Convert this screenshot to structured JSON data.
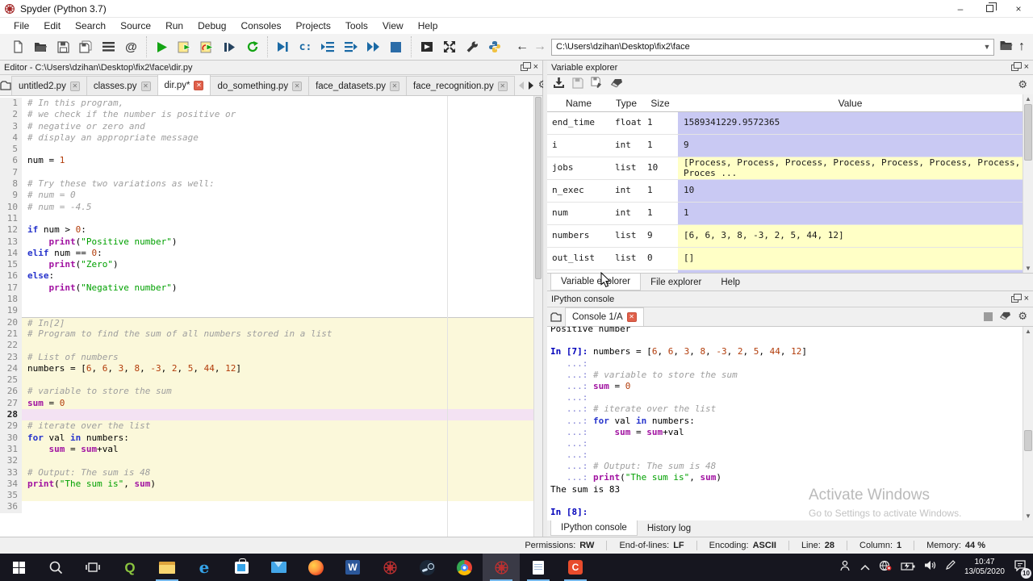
{
  "window": {
    "title": "Spyder (Python 3.7)"
  },
  "menu_bar": {
    "items": [
      "File",
      "Edit",
      "Search",
      "Source",
      "Run",
      "Debug",
      "Consoles",
      "Projects",
      "Tools",
      "View",
      "Help"
    ]
  },
  "toolbar": {
    "path": "C:\\Users\\dzihan\\Desktop\\fix2\\face"
  },
  "editor": {
    "panel_title": "Editor - C:\\Users\\dzihan\\Desktop\\fix2\\face\\dir.py",
    "tabs": [
      {
        "label": "untitled2.py",
        "active": false
      },
      {
        "label": "classes.py",
        "active": false
      },
      {
        "label": "dir.py*",
        "active": true
      },
      {
        "label": "do_something.py",
        "active": false
      },
      {
        "label": "face_datasets.py",
        "active": false
      },
      {
        "label": "face_recognition.py",
        "active": false
      }
    ],
    "lines": [
      {
        "n": 1,
        "bg": "",
        "t": [
          [
            "# In this program,",
            "c"
          ]
        ]
      },
      {
        "n": 2,
        "bg": "",
        "t": [
          [
            "# we check if the number is positive or",
            "c"
          ]
        ]
      },
      {
        "n": 3,
        "bg": "",
        "t": [
          [
            "# negative or zero and",
            "c"
          ]
        ]
      },
      {
        "n": 4,
        "bg": "",
        "t": [
          [
            "# display an appropriate message",
            "c"
          ]
        ]
      },
      {
        "n": 5,
        "bg": "",
        "t": []
      },
      {
        "n": 6,
        "bg": "",
        "t": [
          [
            "num = ",
            "p"
          ],
          [
            "1",
            "n"
          ]
        ]
      },
      {
        "n": 7,
        "bg": "",
        "t": []
      },
      {
        "n": 8,
        "bg": "",
        "t": [
          [
            "# Try these two variations as well:",
            "c"
          ]
        ]
      },
      {
        "n": 9,
        "bg": "",
        "t": [
          [
            "# num = 0",
            "c"
          ]
        ]
      },
      {
        "n": 10,
        "bg": "",
        "t": [
          [
            "# num = -4.5",
            "c"
          ]
        ]
      },
      {
        "n": 11,
        "bg": "",
        "t": []
      },
      {
        "n": 12,
        "bg": "",
        "t": [
          [
            "if",
            "k"
          ],
          [
            " num > ",
            "p"
          ],
          [
            "0",
            "n"
          ],
          [
            ":",
            "p"
          ]
        ]
      },
      {
        "n": 13,
        "bg": "",
        "t": [
          [
            "    ",
            "p"
          ],
          [
            "print",
            "b"
          ],
          [
            "(",
            "p"
          ],
          [
            "\"Positive number\"",
            "s"
          ],
          [
            ")",
            "p"
          ]
        ]
      },
      {
        "n": 14,
        "bg": "",
        "t": [
          [
            "elif",
            "k"
          ],
          [
            " num == ",
            "p"
          ],
          [
            "0",
            "n"
          ],
          [
            ":",
            "p"
          ]
        ]
      },
      {
        "n": 15,
        "bg": "",
        "t": [
          [
            "    ",
            "p"
          ],
          [
            "print",
            "b"
          ],
          [
            "(",
            "p"
          ],
          [
            "\"Zero\"",
            "s"
          ],
          [
            ")",
            "p"
          ]
        ]
      },
      {
        "n": 16,
        "bg": "",
        "t": [
          [
            "else",
            "k"
          ],
          [
            ":",
            "p"
          ]
        ]
      },
      {
        "n": 17,
        "bg": "",
        "t": [
          [
            "    ",
            "p"
          ],
          [
            "print",
            "b"
          ],
          [
            "(",
            "p"
          ],
          [
            "\"Negative number\"",
            "s"
          ],
          [
            ")",
            "p"
          ]
        ]
      },
      {
        "n": 18,
        "bg": "",
        "t": []
      },
      {
        "n": 19,
        "bg": "",
        "t": []
      },
      {
        "n": 20,
        "bg": "cellstart",
        "t": [
          [
            "# In[2]",
            "c"
          ]
        ]
      },
      {
        "n": 21,
        "bg": "cell",
        "t": [
          [
            "# Program to find the sum of all numbers stored in a list",
            "c"
          ]
        ]
      },
      {
        "n": 22,
        "bg": "cell",
        "t": []
      },
      {
        "n": 23,
        "bg": "cell",
        "t": [
          [
            "# List of numbers",
            "c"
          ]
        ]
      },
      {
        "n": 24,
        "bg": "cell",
        "t": [
          [
            "numbers = [",
            "p"
          ],
          [
            "6",
            "n"
          ],
          [
            ", ",
            "p"
          ],
          [
            "6",
            "n"
          ],
          [
            ", ",
            "p"
          ],
          [
            "3",
            "n"
          ],
          [
            ", ",
            "p"
          ],
          [
            "8",
            "n"
          ],
          [
            ", ",
            "p"
          ],
          [
            "-3",
            "n"
          ],
          [
            ", ",
            "p"
          ],
          [
            "2",
            "n"
          ],
          [
            ", ",
            "p"
          ],
          [
            "5",
            "n"
          ],
          [
            ", ",
            "p"
          ],
          [
            "44",
            "n"
          ],
          [
            ", ",
            "p"
          ],
          [
            "12",
            "n"
          ],
          [
            "]",
            "p"
          ]
        ]
      },
      {
        "n": 25,
        "bg": "cell",
        "t": []
      },
      {
        "n": 26,
        "bg": "cell",
        "t": [
          [
            "# variable to store the sum",
            "c"
          ]
        ]
      },
      {
        "n": 27,
        "bg": "cell",
        "t": [
          [
            "sum",
            "b"
          ],
          [
            " = ",
            "p"
          ],
          [
            "0",
            "n"
          ]
        ]
      },
      {
        "n": 28,
        "bg": "cur",
        "t": []
      },
      {
        "n": 29,
        "bg": "cell",
        "t": [
          [
            "# iterate over the list",
            "c"
          ]
        ]
      },
      {
        "n": 30,
        "bg": "cell",
        "t": [
          [
            "for",
            "k"
          ],
          [
            " val ",
            "p"
          ],
          [
            "in",
            "k"
          ],
          [
            " numbers:",
            "p"
          ]
        ]
      },
      {
        "n": 31,
        "bg": "cell",
        "t": [
          [
            "    ",
            "p"
          ],
          [
            "sum",
            "b"
          ],
          [
            " = ",
            "p"
          ],
          [
            "sum",
            "b"
          ],
          [
            "+val",
            "p"
          ]
        ]
      },
      {
        "n": 32,
        "bg": "cell",
        "t": []
      },
      {
        "n": 33,
        "bg": "cell",
        "t": [
          [
            "# Output: The sum is 48",
            "c"
          ]
        ]
      },
      {
        "n": 34,
        "bg": "cell",
        "t": [
          [
            "print",
            "b"
          ],
          [
            "(",
            "p"
          ],
          [
            "\"The sum is\"",
            "s"
          ],
          [
            ", ",
            "p"
          ],
          [
            "sum",
            "b"
          ],
          [
            ")",
            "p"
          ]
        ]
      },
      {
        "n": 35,
        "bg": "cell",
        "t": []
      },
      {
        "n": 36,
        "bg": "",
        "t": []
      }
    ]
  },
  "variable_explorer": {
    "panel_title": "Variable explorer",
    "columns": [
      "Name",
      "Type",
      "Size",
      "Value"
    ],
    "rows": [
      {
        "name": "end_time",
        "type": "float",
        "size": "1",
        "value": "1589341229.9572365",
        "kind": "num"
      },
      {
        "name": "i",
        "type": "int",
        "size": "1",
        "value": "9",
        "kind": "num"
      },
      {
        "name": "jobs",
        "type": "list",
        "size": "10",
        "value": "[Process, Process, Process, Process, Process, Process, Process, Proces ...",
        "kind": "list",
        "wrap": true
      },
      {
        "name": "n_exec",
        "type": "int",
        "size": "1",
        "value": "10",
        "kind": "num"
      },
      {
        "name": "num",
        "type": "int",
        "size": "1",
        "value": "1",
        "kind": "num"
      },
      {
        "name": "numbers",
        "type": "list",
        "size": "9",
        "value": "[6, 6, 3, 8, -3, 2, 5, 44, 12]",
        "kind": "list"
      },
      {
        "name": "out_list",
        "type": "list",
        "size": "0",
        "value": "[]",
        "kind": "list"
      }
    ],
    "tabs": [
      "Variable explorer",
      "File explorer",
      "Help"
    ]
  },
  "console": {
    "panel_title": "IPython console",
    "tab_label": "Console 1/A",
    "bottom_tabs": [
      "IPython console",
      "History log"
    ],
    "lines": [
      [
        [
          "Positive number",
          "o"
        ]
      ],
      [],
      [
        [
          "In [7]: ",
          "P"
        ],
        [
          "numbers = [",
          "p"
        ],
        [
          "6",
          "n"
        ],
        [
          ", ",
          "p"
        ],
        [
          "6",
          "n"
        ],
        [
          ", ",
          "p"
        ],
        [
          "3",
          "n"
        ],
        [
          ", ",
          "p"
        ],
        [
          "8",
          "n"
        ],
        [
          ", ",
          "p"
        ],
        [
          "-3",
          "n"
        ],
        [
          ", ",
          "p"
        ],
        [
          "2",
          "n"
        ],
        [
          ", ",
          "p"
        ],
        [
          "5",
          "n"
        ],
        [
          ", ",
          "p"
        ],
        [
          "44",
          "n"
        ],
        [
          ", ",
          "p"
        ],
        [
          "12",
          "n"
        ],
        [
          "]",
          "p"
        ]
      ],
      [
        [
          "   ...: ",
          "C"
        ]
      ],
      [
        [
          "   ...: ",
          "C"
        ],
        [
          "# variable to store the sum",
          "c"
        ]
      ],
      [
        [
          "   ...: ",
          "C"
        ],
        [
          "sum",
          "b"
        ],
        [
          " = ",
          "p"
        ],
        [
          "0",
          "n"
        ]
      ],
      [
        [
          "   ...: ",
          "C"
        ]
      ],
      [
        [
          "   ...: ",
          "C"
        ],
        [
          "# iterate over the list",
          "c"
        ]
      ],
      [
        [
          "   ...: ",
          "C"
        ],
        [
          "for",
          "k"
        ],
        [
          " val ",
          "p"
        ],
        [
          "in",
          "k"
        ],
        [
          " numbers:",
          "p"
        ]
      ],
      [
        [
          "   ...: ",
          "C"
        ],
        [
          "    ",
          "p"
        ],
        [
          "sum",
          "b"
        ],
        [
          " = ",
          "p"
        ],
        [
          "sum",
          "b"
        ],
        [
          "+val",
          "p"
        ]
      ],
      [
        [
          "   ...: ",
          "C"
        ]
      ],
      [
        [
          "   ...: ",
          "C"
        ]
      ],
      [
        [
          "   ...: ",
          "C"
        ],
        [
          "# Output: The sum is 48",
          "c"
        ]
      ],
      [
        [
          "   ...: ",
          "C"
        ],
        [
          "print",
          "b"
        ],
        [
          "(",
          "p"
        ],
        [
          "\"The sum is\"",
          "s"
        ],
        [
          ", ",
          "p"
        ],
        [
          "sum",
          "b"
        ],
        [
          ")",
          "p"
        ]
      ],
      [
        [
          "The sum is 83",
          "o"
        ]
      ],
      [],
      [
        [
          "In [8]: ",
          "P"
        ]
      ]
    ]
  },
  "status_bar": {
    "items": [
      {
        "label": "Permissions:",
        "value": "RW"
      },
      {
        "label": "End-of-lines:",
        "value": "LF"
      },
      {
        "label": "Encoding:",
        "value": "ASCII"
      },
      {
        "label": "Line:",
        "value": "28"
      },
      {
        "label": "Column:",
        "value": "1"
      },
      {
        "label": "Memory:",
        "value": "44 %"
      }
    ]
  },
  "taskbar": {
    "icons": [
      "start",
      "search",
      "task-view",
      "qgis",
      "file-explorer",
      "edge",
      "store",
      "mail",
      "firefox",
      "word",
      "spyder",
      "steam",
      "chrome",
      "spyder-active",
      "notepad",
      "camtasia"
    ],
    "tray_icons": [
      "people",
      "chevron-up",
      "network-offline",
      "battery",
      "volume",
      "pen",
      "clock",
      "notifications"
    ],
    "qgis_letter": "Q",
    "edge_letter": "e",
    "word_letter": "W",
    "camtasia_letter": "C",
    "clock": {
      "time": "10:47",
      "date": "13/05/2020"
    },
    "notification_badge": "10"
  },
  "watermark": {
    "line1": "Activate Windows",
    "line2": "Go to Settings to activate Windows."
  },
  "colors": {
    "value_num_bg": "#c9c9f3",
    "value_list_bg": "#ffffc6",
    "cell_bg": "#fbf8da",
    "current_line_bg": "#f3e2f3",
    "keyword": "#2633cc",
    "builtin": "#a112a1",
    "string": "#00a000",
    "number": "#b23c0a",
    "comment": "#9e9e9e",
    "prompt": "#0000bb",
    "run_green": "#14a414",
    "debug_blue": "#1b6aa5",
    "taskbar_bg": "#16161f"
  }
}
